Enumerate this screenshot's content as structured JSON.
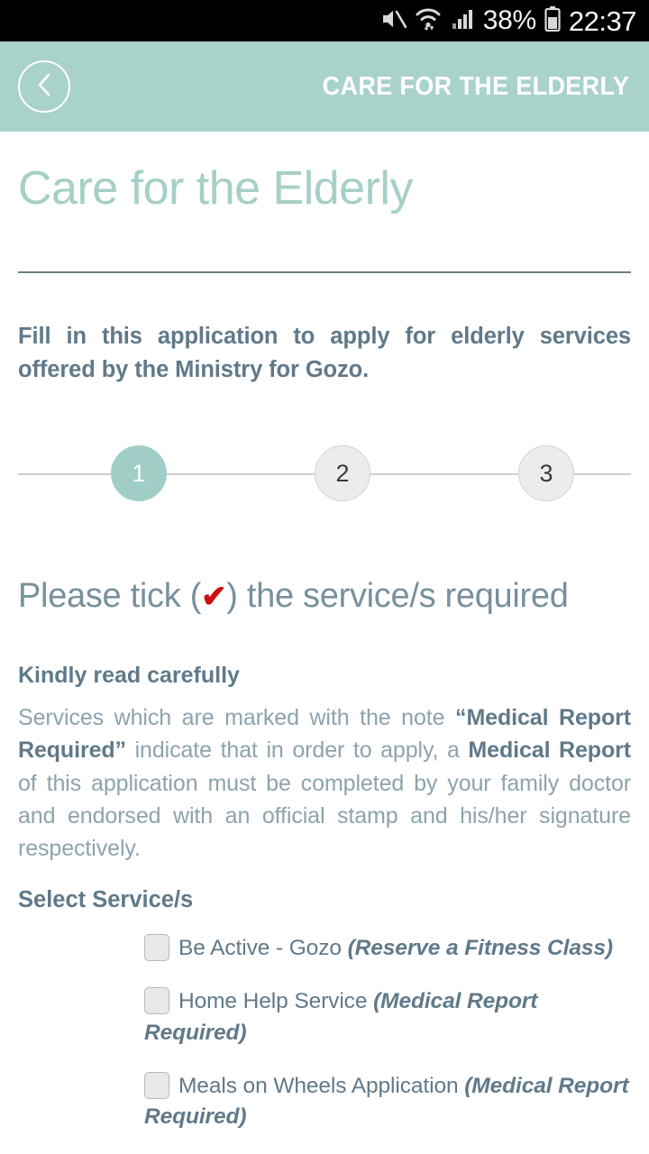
{
  "status_bar": {
    "icons": [
      "mute-icon",
      "wifi-icon",
      "signal-icon",
      "battery-icon"
    ],
    "battery_percent": "38%",
    "time": "22:37"
  },
  "header": {
    "back_icon": "chevron-left-icon",
    "title": "CARE FOR THE ELDERLY",
    "background_color": "#a9d2cb"
  },
  "page": {
    "title": "Care for the Elderly",
    "title_color": "#a5cfc7",
    "intro": "Fill in this application to apply for elderly services offered by the Ministry for Gozo."
  },
  "stepper": {
    "current": 1,
    "steps": [
      {
        "label": "1",
        "state": "active"
      },
      {
        "label": "2",
        "state": "inactive"
      },
      {
        "label": "3",
        "state": "inactive"
      }
    ],
    "active_color": "#a0cec6",
    "inactive_color": "#ececec"
  },
  "tick_heading": {
    "before": "Please tick (",
    "mark": "✔",
    "after": ") the service/s required",
    "mark_color": "#cc1111"
  },
  "notice": {
    "title": "Kindly read carefully",
    "part1": "Services which are marked with the note ",
    "bold1": "“Medical Report Required”",
    "part2": " indicate that in order to apply, a ",
    "bold2": "Medical Report",
    "part3": " of this application must be completed by your family doctor and endorsed with an official stamp and his/her signature respectively."
  },
  "select_services": {
    "title": "Select Service/s",
    "items": [
      {
        "name": "Be Active - Gozo",
        "note": "(Reserve a Fitness Class)",
        "checked": false
      },
      {
        "name": "Home Help Service",
        "note": "(Medical Report Required)",
        "checked": false
      },
      {
        "name": "Meals on Wheels Application",
        "note": "(Medical Report Required)",
        "checked": false
      }
    ]
  }
}
